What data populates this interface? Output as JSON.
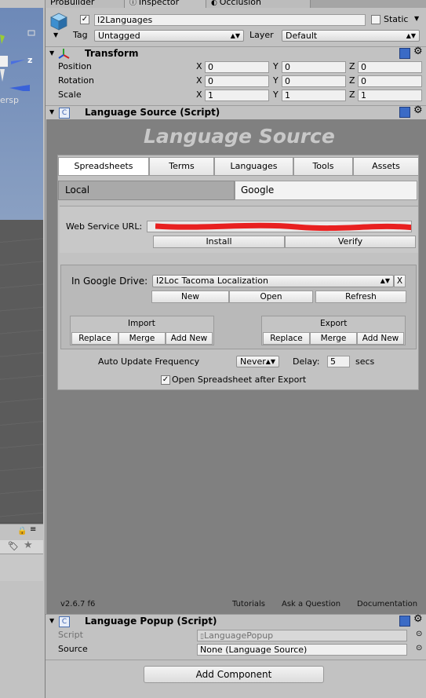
{
  "tabs": [
    {
      "label": "ProBuilder"
    },
    {
      "label": "Inspector"
    },
    {
      "label": "Occlusion"
    }
  ],
  "scene": {
    "axis_z": "z",
    "persp_label": "ersp"
  },
  "gameobject": {
    "name": "I2Languages",
    "static_label": "Static",
    "tag_label": "Tag",
    "tag_value": "Untagged",
    "layer_label": "Layer",
    "layer_value": "Default"
  },
  "transform": {
    "title": "Transform",
    "rows": [
      {
        "label": "Position",
        "x": "0",
        "y": "0",
        "z": "0"
      },
      {
        "label": "Rotation",
        "x": "0",
        "y": "0",
        "z": "0"
      },
      {
        "label": "Scale",
        "x": "1",
        "y": "1",
        "z": "1"
      }
    ],
    "axis": {
      "x": "X",
      "y": "Y",
      "z": "Z"
    }
  },
  "language_source": {
    "title": "Language Source (Script)",
    "banner": "Language Source",
    "tabs": [
      "Spreadsheets",
      "Terms",
      "Languages",
      "Tools",
      "Assets"
    ],
    "subtabs": [
      "Local",
      "Google"
    ],
    "web_service_label": "Web Service URL:",
    "install": "Install",
    "verify": "Verify",
    "drive_label": "In Google Drive:",
    "drive_value": "I2Loc Tacoma Localization",
    "drive_clear": "X",
    "new": "New",
    "open": "Open",
    "refresh": "Refresh",
    "import_title": "Import",
    "export_title": "Export",
    "replace": "Replace",
    "merge": "Merge",
    "add_new": "Add New",
    "auto_update_label": "Auto Update Frequency",
    "auto_update_value": "Never",
    "delay_label": "Delay:",
    "delay_value": "5",
    "delay_unit": "secs",
    "open_after_export": "Open Spreadsheet after Export",
    "version": "v2.6.7 f6",
    "links": [
      "Tutorials",
      "Ask a Question",
      "Documentation"
    ]
  },
  "language_popup": {
    "title": "Language Popup (Script)",
    "script_label": "Script",
    "script_value": "LanguagePopup",
    "source_label": "Source",
    "source_value": "None (Language Source)"
  },
  "add_component": "Add Component"
}
